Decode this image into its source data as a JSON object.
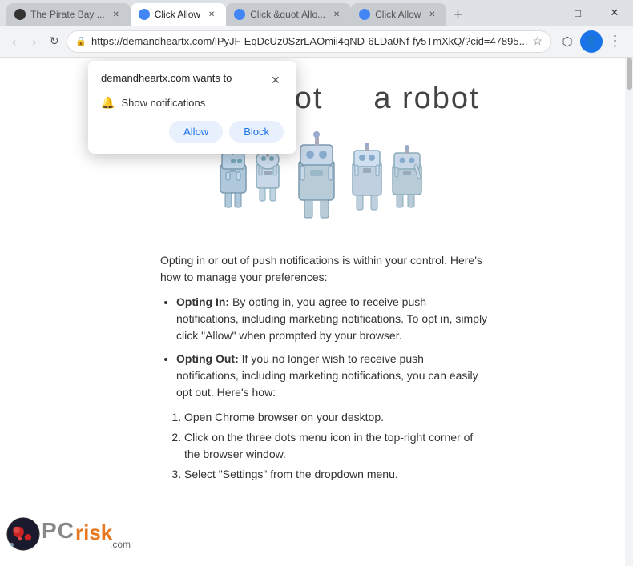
{
  "browser": {
    "tabs": [
      {
        "id": "tab1",
        "label": "The Pirate Bay ...",
        "active": false,
        "favicon": "pirate"
      },
      {
        "id": "tab2",
        "label": "Click Allow",
        "active": true,
        "favicon": "blue"
      },
      {
        "id": "tab3",
        "label": "Click &quot;Allo...",
        "active": false,
        "favicon": "blue"
      },
      {
        "id": "tab4",
        "label": "Click Allow",
        "active": false,
        "favicon": "blue"
      }
    ],
    "new_tab_icon": "+",
    "address_bar": "https://demandheartx.com/lPyJF-EqDcUz0SzrLAOmii4qND-6LDa0Nf-fy5TmXkQ/?cid=47895...",
    "win_controls": {
      "minimize": "—",
      "maximize": "□",
      "close": "✕"
    }
  },
  "nav_buttons": {
    "back": "‹",
    "forward": "›",
    "reload": "↻"
  },
  "notification_popup": {
    "title": "demandheartx.com wants to",
    "close": "✕",
    "permission_icon": "🔔",
    "permission_text": "Show notifications",
    "allow_label": "Allow",
    "block_label": "Block"
  },
  "page": {
    "not_robot_text": "you are not",
    "not_robot_text2": "a robot",
    "article_intro": "Opting in or out of push notifications is within your control. Here's how to manage your preferences:",
    "bullets": [
      {
        "title": "Opting In:",
        "text": " By opting in, you agree to receive push notifications, including marketing notifications. To opt in, simply click \"Allow\" when prompted by your browser."
      },
      {
        "title": "Opting Out:",
        "text": " If you no longer wish to receive push notifications, including marketing notifications, you can easily opt out. Here's how:"
      }
    ],
    "steps": [
      "Open Chrome browser on your desktop.",
      "Click on the three dots menu icon in the top-right corner of the browser window.",
      "Select \"Settings\" from the dropdown menu."
    ]
  }
}
